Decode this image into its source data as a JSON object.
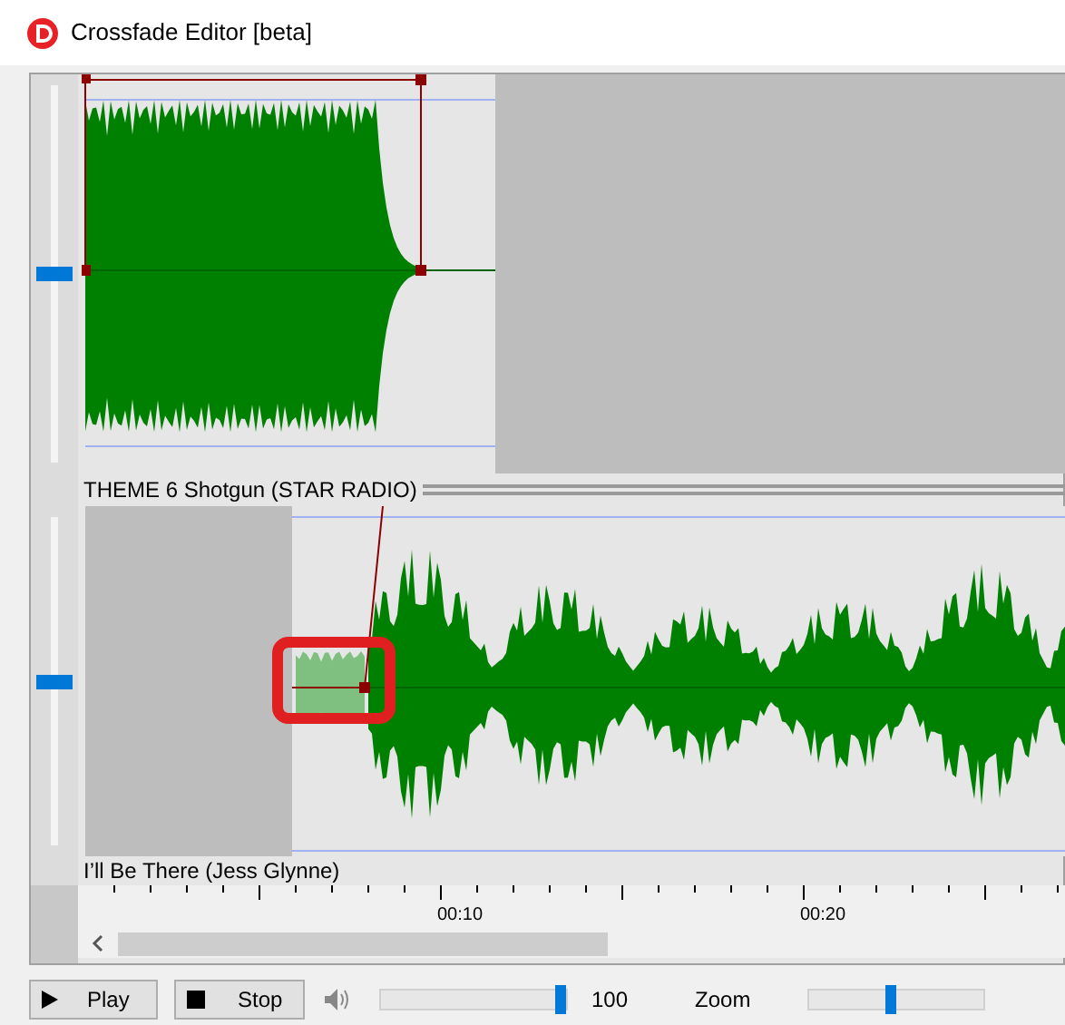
{
  "window": {
    "title": "Crossfade Editor [beta]"
  },
  "tracks": [
    {
      "label": "THEME 6 Shotgun (STAR RADIO)",
      "level": 0.5
    },
    {
      "label": "I’ll Be There (Jess Glynne)",
      "level": 0.5
    }
  ],
  "timeline": {
    "ticks": [
      "00:10",
      "00:20"
    ]
  },
  "controls": {
    "play": "Play",
    "stop": "Stop",
    "volume": {
      "level": 0.97,
      "reading": "100"
    },
    "zoom": {
      "label": "Zoom",
      "level": 0.47
    }
  }
}
